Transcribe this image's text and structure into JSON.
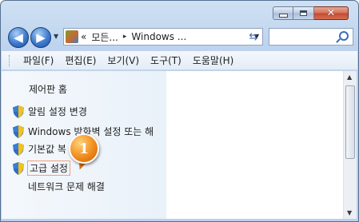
{
  "window": {
    "accent": "#bdd3ee",
    "caption": {
      "minimize": "minimize",
      "maximize": "maximize",
      "close": "✕"
    }
  },
  "address": {
    "prefix": "«",
    "crumbs": [
      "모든...",
      "Windows ..."
    ],
    "separator": "▸"
  },
  "search": {
    "placeholder": ""
  },
  "menu": [
    "파일(F)",
    "편집(E)",
    "보기(V)",
    "도구(T)",
    "도움말(H)"
  ],
  "left_pane": {
    "home": "제어판 홈",
    "tasks": [
      {
        "label": "알림 설정 변경",
        "icon": "shield-icon"
      },
      {
        "label": "Windows 방화벽 설정 또는 해",
        "icon": "shield-icon"
      },
      {
        "label": "기본값 복",
        "icon": "shield-icon"
      },
      {
        "label": "고급 설정",
        "icon": "shield-icon",
        "highlighted": true
      },
      {
        "label": "네트워크 문제 해결"
      }
    ]
  },
  "callout": {
    "number": "1",
    "color": "#f08c1c"
  }
}
